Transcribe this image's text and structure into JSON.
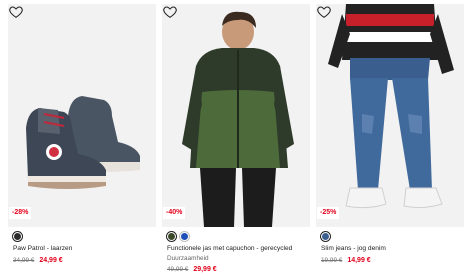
{
  "products": [
    {
      "title": "Paw Patrol - laarzen",
      "subtitle": "",
      "discount": "-28%",
      "old_price": "34,99 €",
      "new_price": "24,99 €",
      "swatches": [
        "#2b2b2b"
      ]
    },
    {
      "title": "Functionele jas met capuchon - gerecycled",
      "subtitle": "Duurzaamheid",
      "discount": "-40%",
      "old_price": "49,99 €",
      "new_price": "29,99 €",
      "swatches": [
        "#3d4a2a",
        "#1f4fb8"
      ]
    },
    {
      "title": "Slim jeans - jog denim",
      "subtitle": "",
      "discount": "-25%",
      "old_price": "19,99 €",
      "new_price": "14,99 €",
      "swatches": [
        "#3a5f8f"
      ]
    }
  ],
  "icons": {
    "wishlist": "heart-outline-icon"
  },
  "colors": {
    "sale_red": "#e2001a",
    "image_bg": "#f2f2f2"
  }
}
